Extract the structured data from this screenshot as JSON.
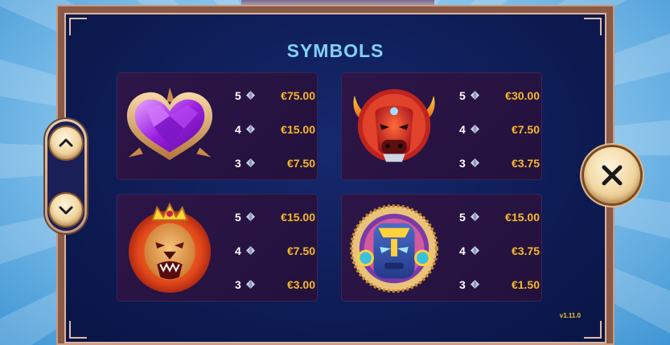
{
  "header": {
    "title": "SYMBOLS"
  },
  "version": "v1.11.0",
  "navigation": {
    "up_icon": "chevron-up-icon",
    "down_icon": "chevron-down-icon",
    "close_icon": "close-x-icon"
  },
  "symbols": [
    {
      "name": "purple-heart-gem",
      "payouts": [
        {
          "count": "5",
          "value": "€75.00"
        },
        {
          "count": "4",
          "value": "€15.00"
        },
        {
          "count": "3",
          "value": "€7.50"
        }
      ]
    },
    {
      "name": "red-bull",
      "payouts": [
        {
          "count": "5",
          "value": "€30.00"
        },
        {
          "count": "4",
          "value": "€7.50"
        },
        {
          "count": "3",
          "value": "€3.75"
        }
      ]
    },
    {
      "name": "crowned-lion",
      "payouts": [
        {
          "count": "5",
          "value": "€15.00"
        },
        {
          "count": "4",
          "value": "€7.50"
        },
        {
          "count": "3",
          "value": "€3.00"
        }
      ]
    },
    {
      "name": "tribal-mask",
      "payouts": [
        {
          "count": "5",
          "value": "€15.00"
        },
        {
          "count": "4",
          "value": "€3.75"
        },
        {
          "count": "3",
          "value": "€1.50"
        }
      ]
    }
  ],
  "colors": {
    "title": "#7fd2f7",
    "payout": "#f5b92b",
    "count": "#ffffff",
    "panel_bg": "#0e1c55",
    "card_bg": "#2d1648",
    "frame": "#8a5a47"
  }
}
